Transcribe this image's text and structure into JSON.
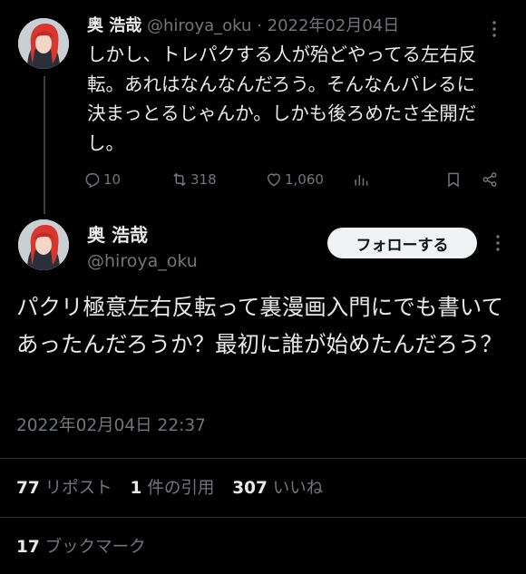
{
  "reply_tweet": {
    "name": "奥 浩哉",
    "handle": "@hiroya_oku",
    "separator": "·",
    "date": "2022年02月04日",
    "body": "しかし、トレパクする人が殆どやってる左右反転。あれはなんなんだろう。そんなんバレるに決まっとるじゃんか。しかも後ろめたさ全開だし。",
    "actions": {
      "replies": "10",
      "retweets": "318",
      "likes": "1,060"
    }
  },
  "main_tweet": {
    "name": "奥 浩哉",
    "handle": "@hiroya_oku",
    "follow_label": "フォローする",
    "body": "パクリ極意左右反転って裏漫画入門にでも書いてあったんだろうか？最初に誰が始めたんだろう？",
    "timestamp": "2022年02月04日 22:37",
    "stats": {
      "retweets_count": "77",
      "retweets_label": "リポスト",
      "quotes_count": "1",
      "quotes_label": "件の引用",
      "likes_count": "307",
      "likes_label": "いいね"
    },
    "bookmarks": {
      "count": "17",
      "label": "ブックマーク"
    }
  },
  "colors": {
    "background": "#000000",
    "text": "#e7e9ea",
    "muted": "#71767b",
    "divider": "#2f3336",
    "follow_bg": "#eff3f4"
  },
  "icons": [
    "more-icon",
    "reply-icon",
    "retweet-icon",
    "like-icon",
    "analytics-icon",
    "bookmark-icon",
    "share-icon"
  ]
}
